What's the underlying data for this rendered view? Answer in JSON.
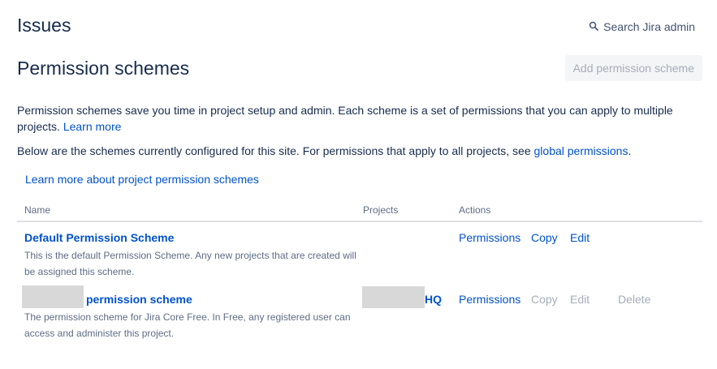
{
  "header": {
    "section_title": "Issues",
    "search_label": "Search Jira admin",
    "search_icon": "search-icon"
  },
  "page": {
    "title": "Permission schemes",
    "add_button": "Add permission scheme",
    "intro_text": "Permission schemes save you time in project setup and admin. Each scheme is a set of permissions that you can apply to multiple projects.",
    "intro_link": "Learn more",
    "below_text": "Below are the schemes currently configured for this site. For permissions that apply to all projects, see",
    "global_link": "global permissions",
    "below_end": ".",
    "learn_schemes_link": "Learn more about project permission schemes"
  },
  "table": {
    "headers": {
      "name": "Name",
      "projects": "Projects",
      "actions": "Actions"
    },
    "rows": [
      {
        "name": "Default Permission Scheme",
        "description": "This is the default Permission Scheme. Any new projects that are created will be assigned this scheme.",
        "projects": "",
        "actions": {
          "permissions": "Permissions",
          "copy": "Copy",
          "edit": "Edit"
        }
      },
      {
        "name": "permission scheme",
        "description": "The permission scheme for Jira Core Free. In Free, any registered user can access and administer this project.",
        "projects": "HQ",
        "actions": {
          "permissions": "Permissions",
          "copy": "Copy",
          "edit": "Edit",
          "delete": "Delete"
        }
      }
    ]
  },
  "colors": {
    "link": "#0052cc",
    "text": "#172b4d",
    "subtle": "#5e6c84",
    "disabled": "#a5adba",
    "border": "#dfe1e6"
  }
}
